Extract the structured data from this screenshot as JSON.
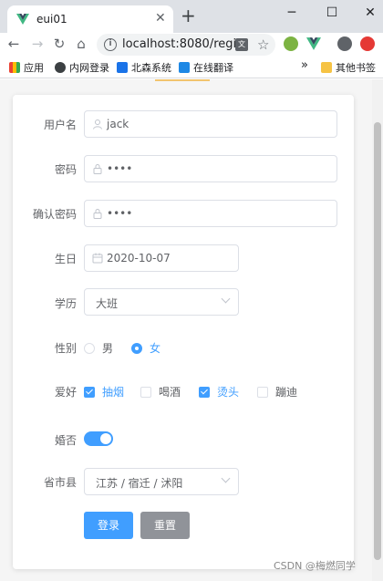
{
  "browser": {
    "tab_title": "eui01",
    "url": "localhost:8080/regi...",
    "bookmarks": [
      {
        "label": "应用"
      },
      {
        "label": "内网登录"
      },
      {
        "label": "北森系统"
      },
      {
        "label": "在线翻译"
      }
    ],
    "more_bookmarks": "»",
    "other_bookmarks": "其他书签"
  },
  "form": {
    "username_label": "用户名",
    "username_value": "jack",
    "password_label": "密码",
    "password_value": "••••",
    "confirm_label": "确认密码",
    "confirm_value": "••••",
    "birthday_label": "生日",
    "birthday_value": "2020-10-07",
    "education_label": "学历",
    "education_value": "大班",
    "gender_label": "性别",
    "gender_options": [
      {
        "label": "男",
        "checked": false
      },
      {
        "label": "女",
        "checked": true
      }
    ],
    "hobby_label": "爱好",
    "hobby_options": [
      {
        "label": "抽烟",
        "checked": true
      },
      {
        "label": "喝酒",
        "checked": false
      },
      {
        "label": "烫头",
        "checked": true
      },
      {
        "label": "蹦迪",
        "checked": false
      }
    ],
    "married_label": "婚否",
    "married_on": true,
    "region_label": "省市县",
    "region_value": "江苏 / 宿迁 / 沭阳",
    "login_button": "登录",
    "reset_button": "重置"
  },
  "watermark": "CSDN @梅燃同学",
  "colors": {
    "primary": "#409eff",
    "info": "#909399"
  }
}
